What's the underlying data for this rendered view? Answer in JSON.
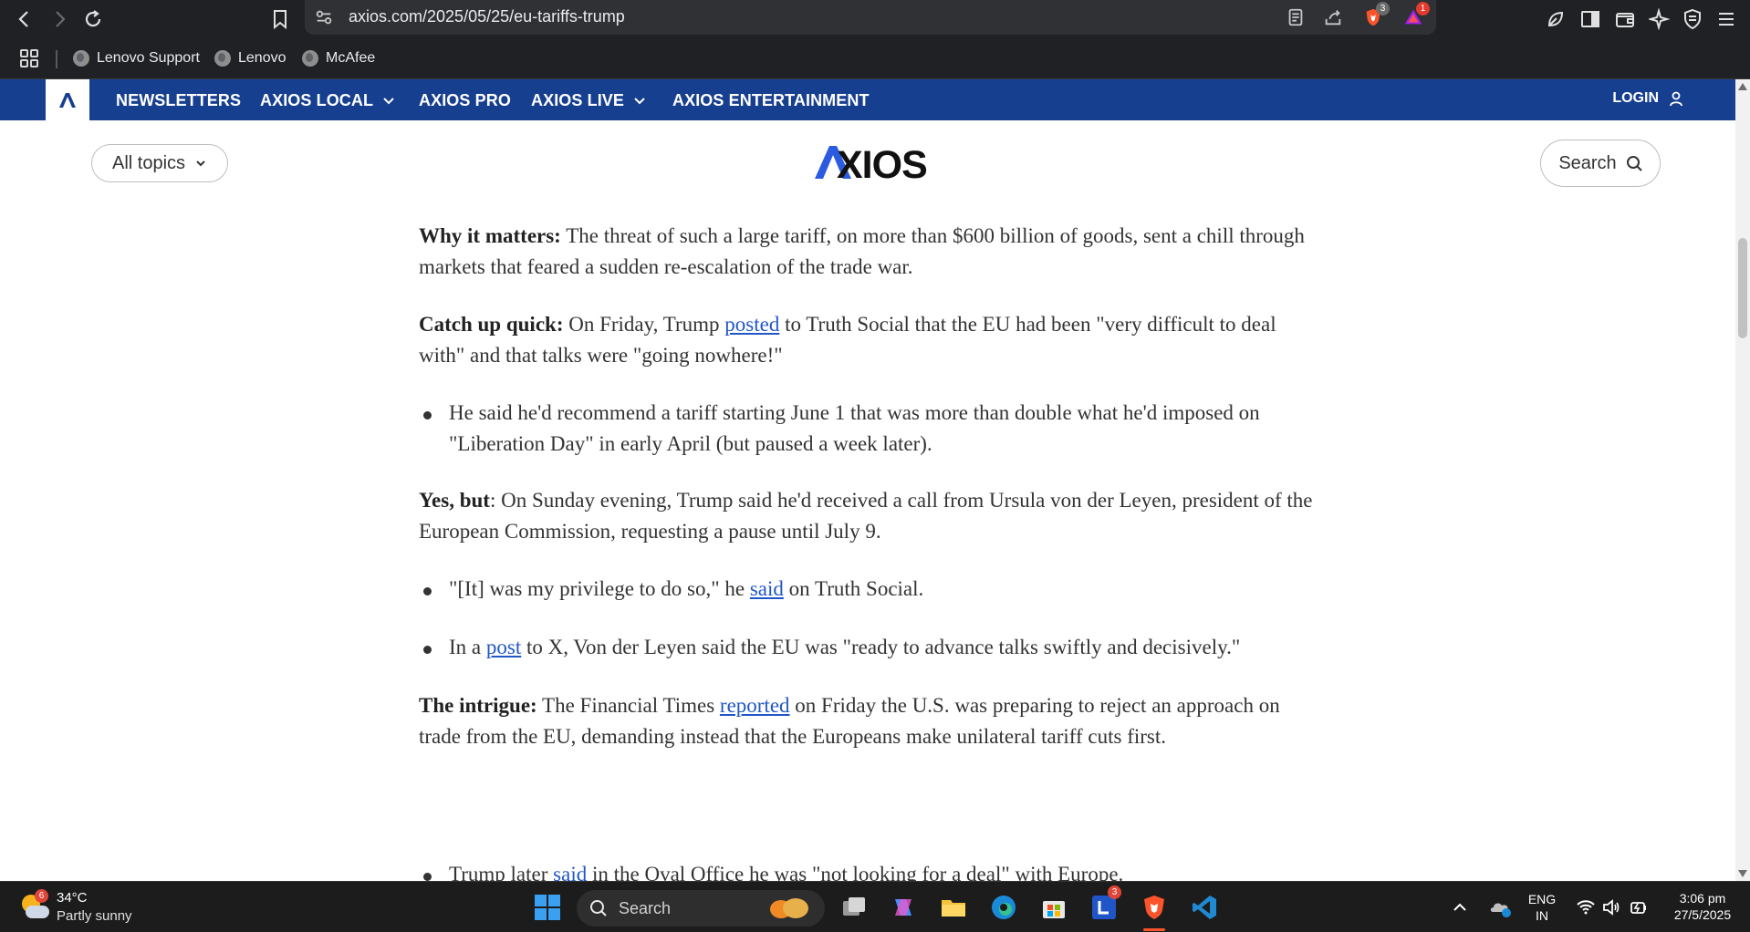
{
  "browser": {
    "url": "axios.com/2025/05/25/eu-tariffs-trump",
    "bookmarks": [
      "Lenovo Support",
      "Lenovo",
      "McAfee"
    ],
    "brave_badge": "3",
    "rewards_badge": "1"
  },
  "nav": {
    "items": [
      {
        "label": "NEWSLETTERS"
      },
      {
        "label": "AXIOS LOCAL"
      },
      {
        "label": "AXIOS PRO"
      },
      {
        "label": "AXIOS LIVE"
      },
      {
        "label": "AXIOS ENTERTAINMENT"
      }
    ],
    "login": "LOGIN"
  },
  "header": {
    "topics_label": "All topics",
    "logo_text": "AXIOS",
    "search_label": "Search"
  },
  "article": {
    "p1": {
      "lead": "Why it matters:",
      "text": " The threat of such a large tariff, on more than $600 billion of goods, sent a chill through markets that feared a sudden re-escalation of the trade war."
    },
    "p2": {
      "lead": "Catch up quick:",
      "pre": " On Friday, Trump ",
      "link": "posted",
      "post": " to Truth Social that the EU had been \"very difficult to deal with\" and that talks were \"going nowhere!\""
    },
    "b1": {
      "text": "He said he'd recommend a tariff starting June 1 that was more than double what he'd imposed on \"Liberation Day\" in early April (but paused a week later)."
    },
    "p3": {
      "lead": "Yes, but",
      "text": ": On Sunday evening, Trump said he'd received a call from Ursula von der Leyen, president of the European Commission, requesting a pause until July 9."
    },
    "b2": {
      "pre": "\"[It] was my privilege to do so,\" he ",
      "link": "said",
      "post": " on Truth Social."
    },
    "b3": {
      "pre": "In a ",
      "link": "post",
      "post": " to X, Von der Leyen said the EU was \"ready to advance talks swiftly and decisively.\""
    },
    "p4": {
      "lead": "The intrigue:",
      "pre": " The Financial Times ",
      "link": "reported",
      "post": " on Friday the U.S. was preparing to reject an approach on trade from the EU, demanding instead that the Europeans make unilateral tariff cuts first."
    },
    "b4": {
      "pre": "Trump later ",
      "link": "said",
      "post": " in the Oval Office he was \"not looking for a deal\" with Europe."
    }
  },
  "taskbar": {
    "weather_temp": "34°C",
    "weather_desc": "Partly sunny",
    "weather_badge": "6",
    "search_label": "Search",
    "lens_badge": "3",
    "lang_top": "ENG",
    "lang_bottom": "IN",
    "time": "3:06 pm",
    "date": "27/5/2025"
  },
  "colors": {
    "nav_bg": "#173f8f",
    "link": "#2156c7",
    "chrome_bg": "#202124",
    "taskbar_bg": "#1c1c1c"
  }
}
